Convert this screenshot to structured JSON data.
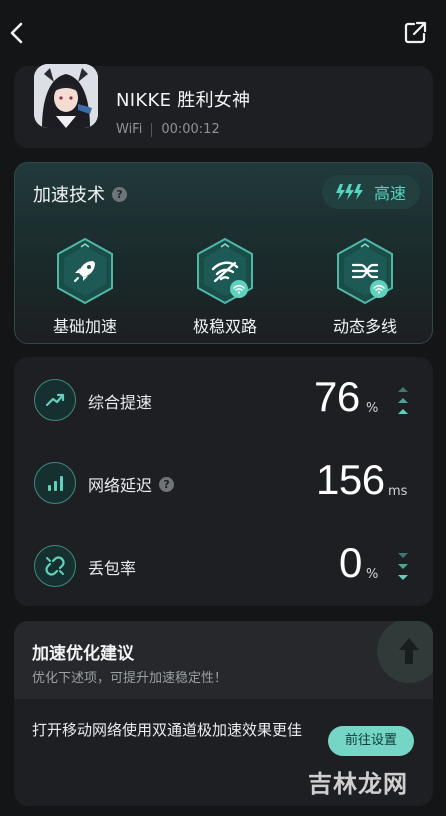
{
  "game": {
    "title": "NIKKE 胜利女神",
    "network": "WiFi",
    "elapsed": "00:00:12"
  },
  "acceleration": {
    "title": "加速技术",
    "speed_badge": "高速",
    "features": [
      {
        "label": "基础加速",
        "icon": "rocket-icon"
      },
      {
        "label": "极稳双路",
        "icon": "dual-wifi-icon"
      },
      {
        "label": "动态多线",
        "icon": "multi-line-icon"
      }
    ]
  },
  "stats": {
    "speedup": {
      "label": "综合提速",
      "value": "76",
      "unit": "%",
      "trend": "up"
    },
    "latency": {
      "label": "网络延迟",
      "value": "156",
      "unit": "ms"
    },
    "packet_loss": {
      "label": "丢包率",
      "value": "0",
      "unit": "%",
      "trend": "down"
    }
  },
  "advice": {
    "title": "加速优化建议",
    "subtitle": "优化下述项，可提升加速稳定性！",
    "item_text": "打开移动网络使用双通道极加速效果更佳",
    "button_label": "前往设置"
  },
  "watermark": "吉林龙网",
  "colors": {
    "accent": "#52d6c0",
    "background": "#141517",
    "card": "#1e1f22",
    "button": "#75d6c5"
  }
}
